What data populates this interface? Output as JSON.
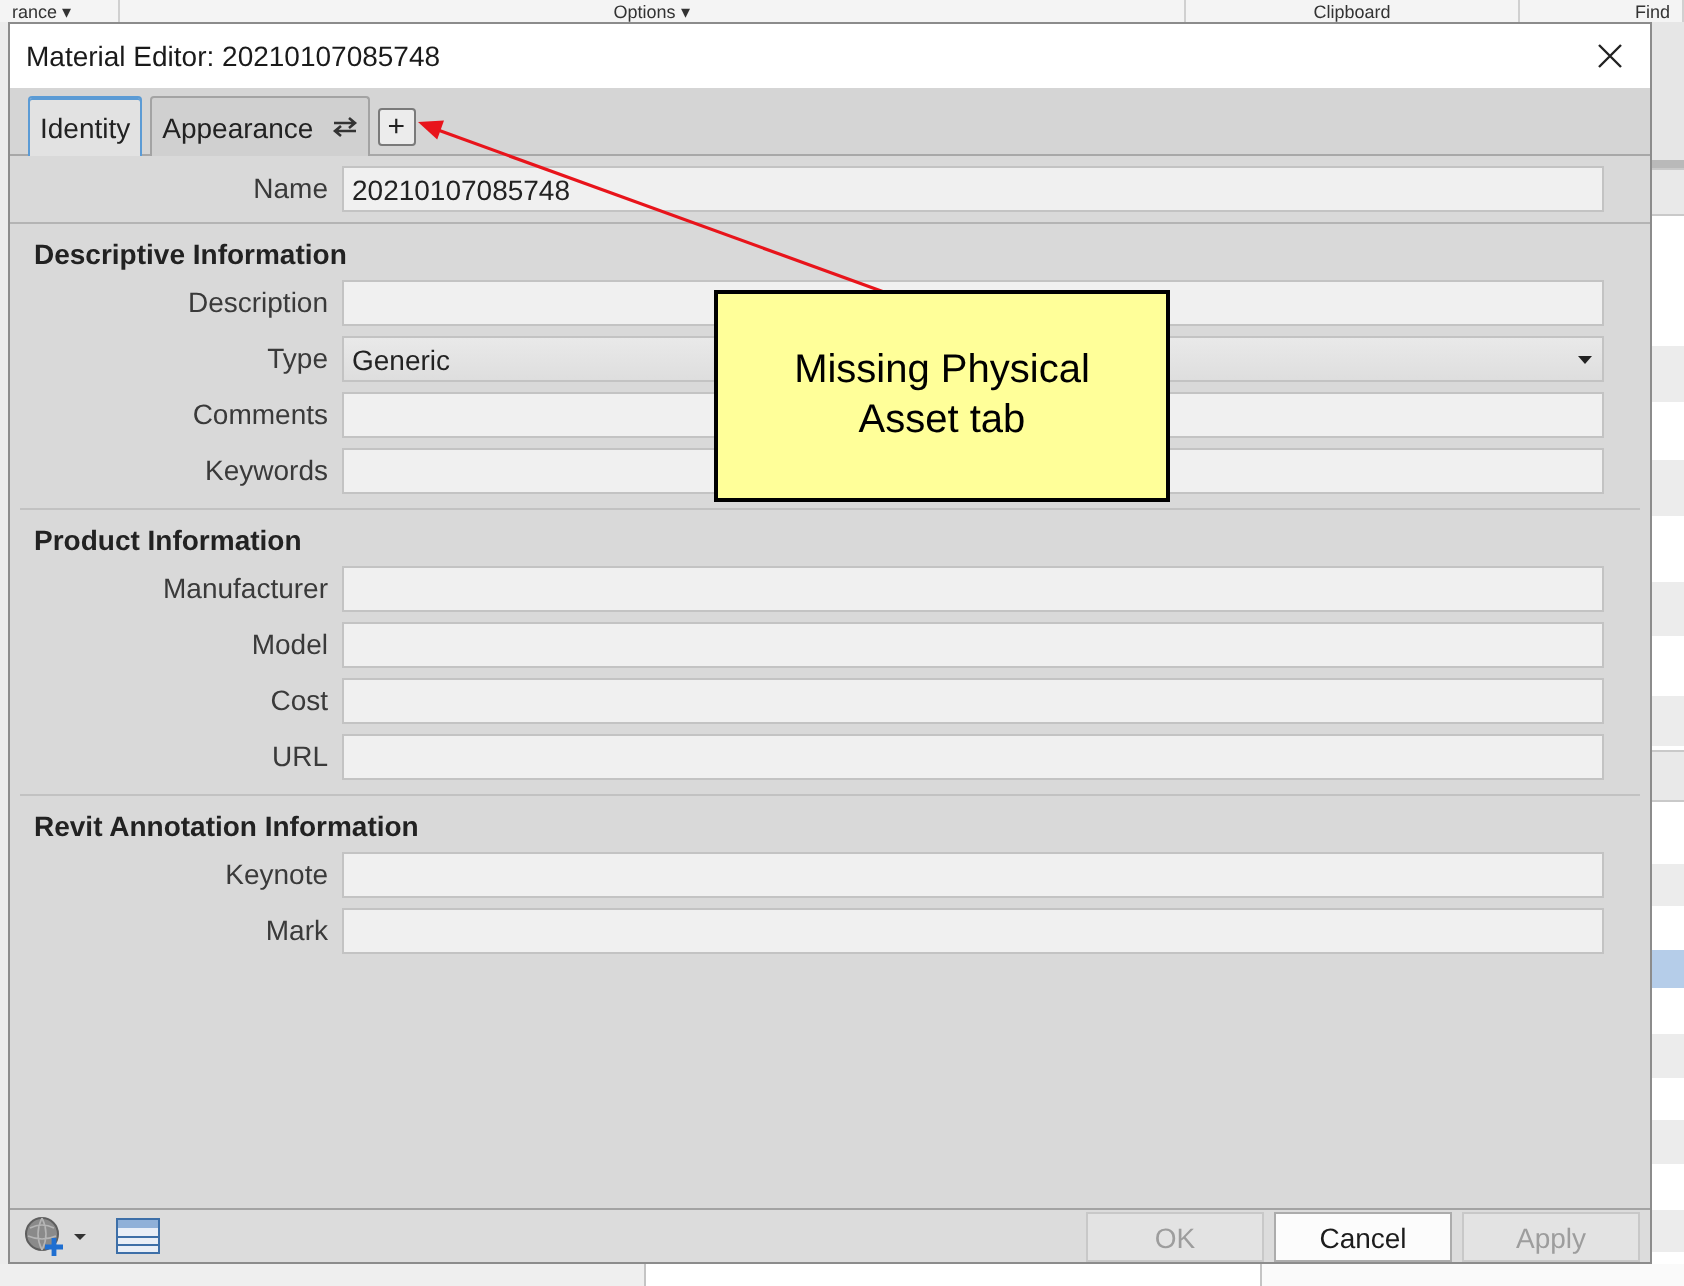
{
  "background": {
    "ribbon_labels": [
      "rance ▾",
      "Options ▾",
      "Clipboard",
      "Find"
    ]
  },
  "window": {
    "title": "Material Editor: 20210107085748"
  },
  "tabs": [
    {
      "label": "Identity",
      "selected": true,
      "kind": "plain"
    },
    {
      "label": "Appearance",
      "selected": false,
      "kind": "swap"
    }
  ],
  "add_tab_button": "+",
  "name_field": {
    "label": "Name",
    "value": "20210107085748"
  },
  "sections": [
    {
      "title": "Descriptive Information",
      "fields": [
        {
          "label": "Description",
          "kind": "text"
        },
        {
          "label": "Type",
          "kind": "dropdown",
          "value": "Generic"
        },
        {
          "label": "Comments",
          "kind": "text"
        },
        {
          "label": "Keywords",
          "kind": "text"
        }
      ]
    },
    {
      "title": "Product Information",
      "fields": [
        {
          "label": "Manufacturer",
          "kind": "text"
        },
        {
          "label": "Model",
          "kind": "text"
        },
        {
          "label": "Cost",
          "kind": "text"
        },
        {
          "label": "URL",
          "kind": "text"
        }
      ]
    },
    {
      "title": "Revit Annotation Information",
      "fields": [
        {
          "label": "Keynote",
          "kind": "text"
        },
        {
          "label": "Mark",
          "kind": "text"
        }
      ]
    }
  ],
  "footer_buttons": [
    {
      "label": "OK",
      "disabled": true
    },
    {
      "label": "Cancel",
      "disabled": false
    },
    {
      "label": "Apply",
      "disabled": true
    }
  ],
  "callout": {
    "text": "Missing Physical Asset tab"
  }
}
